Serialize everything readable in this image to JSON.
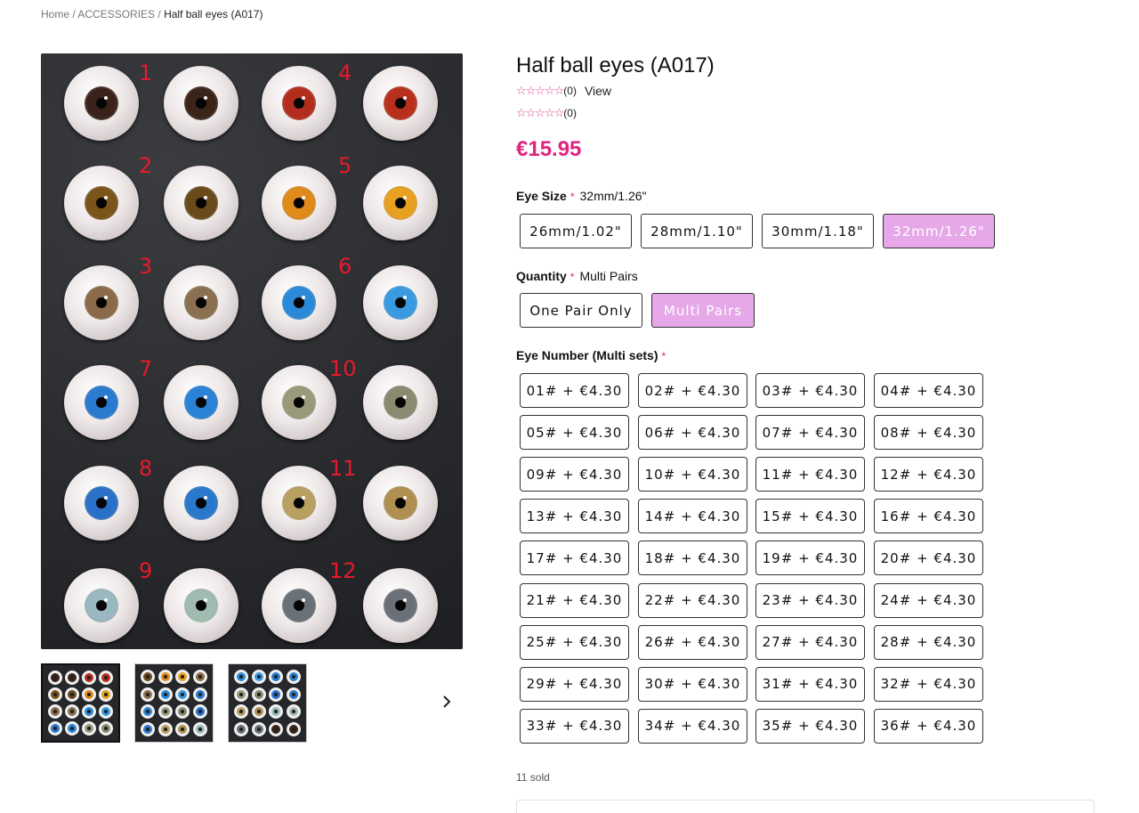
{
  "breadcrumb": {
    "home": "Home",
    "category": "ACCESSORIES",
    "current": "Half ball eyes (A017)"
  },
  "product": {
    "title": "Half ball eyes (A017)",
    "rating_stars": "☆☆☆☆☆",
    "rating_count_1": "(0)",
    "view_link": "View",
    "rating_count_2": "(0)",
    "price": "€15.95",
    "sold": "11 sold"
  },
  "eye_size": {
    "label": "Eye Size",
    "required": "*",
    "selected": "32mm/1.26\"",
    "options": [
      "26mm/1.02\"",
      "28mm/1.10\"",
      "30mm/1.18\"",
      "32mm/1.26\""
    ]
  },
  "quantity": {
    "label": "Quantity",
    "required": "*",
    "selected": "Multi Pairs",
    "options": [
      "One Pair Only",
      "Multi Pairs"
    ]
  },
  "eye_number": {
    "label": "Eye Number (Multi sets)",
    "required": "*",
    "options": [
      "01# + €4.30",
      "02# + €4.30",
      "03# + €4.30",
      "04# + €4.30",
      "05# + €4.30",
      "06# + €4.30",
      "07# + €4.30",
      "08# + €4.30",
      "09# + €4.30",
      "10# + €4.30",
      "11# + €4.30",
      "12# + €4.30",
      "13# + €4.30",
      "14# + €4.30",
      "15# + €4.30",
      "16# + €4.30",
      "17# + €4.30",
      "18# + €4.30",
      "19# + €4.30",
      "20# + €4.30",
      "21# + €4.30",
      "22# + €4.30",
      "23# + €4.30",
      "24# + €4.30",
      "25# + €4.30",
      "26# + €4.30",
      "27# + €4.30",
      "28# + €4.30",
      "29# + €4.30",
      "30# + €4.30",
      "31# + €4.30",
      "32# + €4.30",
      "33# + €4.30",
      "34# + €4.30",
      "35# + €4.30",
      "36# + €4.30"
    ]
  },
  "photo": {
    "numbers": [
      "1",
      "4",
      "2",
      "5",
      "3",
      "6",
      "7",
      "10",
      "8",
      "11",
      "9",
      "12"
    ],
    "iris_colors": [
      [
        "#3a221a",
        "#3a2418",
        "#b32d1c",
        "#b8301c"
      ],
      [
        "#7a5418",
        "#6a4a1a",
        "#e08a1a",
        "#e8a020"
      ],
      [
        "#8a6a48",
        "#8a7050",
        "#2a8ad8",
        "#3a9ae0"
      ],
      [
        "#2a7ad0",
        "#2a82d6",
        "#9a9a7a",
        "#8a8a70"
      ],
      [
        "#2a70c8",
        "#2a78cc",
        "#b8a060",
        "#b09050"
      ],
      [
        "#9ab8c0",
        "#a0bcb0",
        "#6a7078",
        "#6a7078"
      ]
    ]
  },
  "icons": {
    "next": "chevron-right-icon",
    "star": "star-outline-icon"
  },
  "colors": {
    "accent": "#e0247f",
    "selected_option": "#e6a8e8"
  }
}
